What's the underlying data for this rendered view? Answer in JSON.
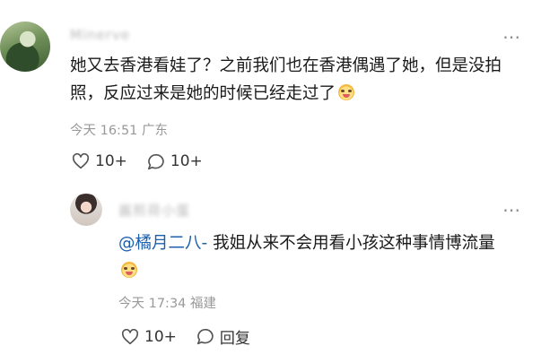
{
  "comments": [
    {
      "username": "Minerve",
      "content": "她又去香港看娃了？之前我们也在香港偶遇了她，但是没拍照，反应过来是她的时候已经走过了",
      "time": "今天 16:51",
      "location": "广东",
      "likes": "10+",
      "replies": "10+",
      "emoji_icon": "crying-face-icon"
    }
  ],
  "reply": {
    "username": "酱煎荷小蛋",
    "mention": "@橘月二八-",
    "content": "我姐从来不会用看小孩这种事情博流量",
    "time": "今天 17:34",
    "location": "福建",
    "likes": "10+",
    "reply_label": "回复",
    "emoji_icon": "crying-face-icon"
  },
  "more_symbol": "⋮"
}
